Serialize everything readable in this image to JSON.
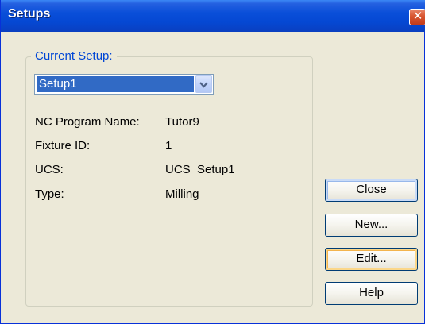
{
  "window": {
    "title": "Setups",
    "close_glyph": "✕"
  },
  "group": {
    "label": "Current Setup:"
  },
  "setup_select": {
    "selected": "Setup1"
  },
  "info": [
    {
      "label": "NC Program Name:",
      "value": "Tutor9"
    },
    {
      "label": "Fixture ID:",
      "value": "1"
    },
    {
      "label": "UCS:",
      "value": "UCS_Setup1"
    },
    {
      "label": "Type:",
      "value": "Milling"
    }
  ],
  "buttons": {
    "close": "Close",
    "new": "New...",
    "edit": "Edit...",
    "help": "Help"
  },
  "colors": {
    "titlebar": "#0548d3",
    "selection": "#316ac5",
    "group_label": "#0046d5",
    "dialog_bg": "#ece9d8"
  }
}
